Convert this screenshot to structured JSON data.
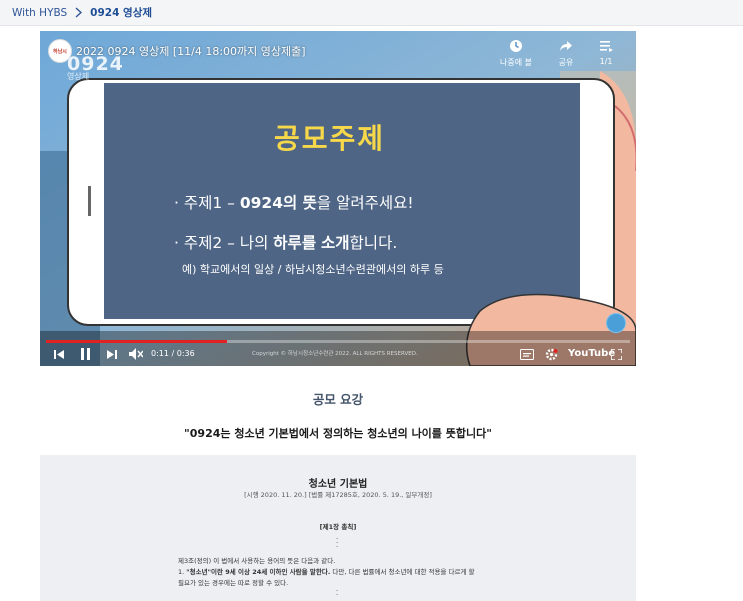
{
  "breadcrumb": {
    "home": "With HYBS",
    "current": "0924 영상제"
  },
  "video": {
    "title": "2022 0924 영상제 [11/4 18:00까지 영상제출]",
    "channel_logo_text": "하남시",
    "watermark_big": "0924",
    "watermark_small": "영상제",
    "watch_later_label": "나중에 볼",
    "share_label": "공유",
    "playlist_label": "1/1",
    "screen": {
      "heading": "공모주제",
      "bullet1_prefix": "주제1 – ",
      "bullet1_bold": "0924의 뜻",
      "bullet1_suffix": "을 알려주세요!",
      "bullet2_prefix": "주제2 – 나의 ",
      "bullet2_bold1": "하루를",
      "bullet2_mid": " ",
      "bullet2_bold2": "소개",
      "bullet2_suffix": "합니다.",
      "example": "예) 학교에서의 일상 / 하남시청소년수련관에서의 하루 등"
    },
    "copyright": "Copyright © 하남시청소년수련관 2022. ALL RIGHTS RESERVED.",
    "time": "0:11 / 0:36",
    "progress": 0.31,
    "youtube_label": "YouTube"
  },
  "content": {
    "section_title": "공모 요강",
    "quote": "\"0924는 청소년 기본법에서 정의하는 청소년의 나이를 뜻합니다\"",
    "law": {
      "title": "청소년 기본법",
      "subtitle": "[시행 2020. 11. 20.] [법률 제17285호, 2020. 5. 19., 일부개정]",
      "chapter": "[제1장 총칙]",
      "article_intro": "제3조(정의) 이 법에서 사용하는 용어의 뜻은 다음과 같다.",
      "item1_prefix": "1. ",
      "item1_bold": "\"청소년\"이란 9세 이상 24세 이하인 사람을 말한다.",
      "item1_rest": " 다만, 다른 법률에서 청소년에 대한 적용을 다르게 할",
      "item1_cont": "필요가 있는 경우에는 따로 정할 수 있다."
    }
  },
  "colors": {
    "screen_bg": "#4e6585",
    "heading_yellow": "#f6d84a",
    "progress_red": "#e02222",
    "law_box_bg": "#eeeff2"
  }
}
